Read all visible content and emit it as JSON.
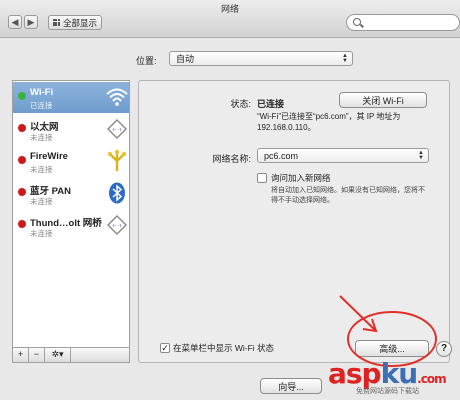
{
  "window": {
    "title": "网络"
  },
  "toolbar": {
    "back": "◀",
    "forward": "▶",
    "show_all": "全部显示",
    "search_placeholder": ""
  },
  "location": {
    "label": "位置:",
    "value": "自动"
  },
  "services": [
    {
      "name": "Wi-Fi",
      "status": "已连接",
      "dot_color": "#3cb43c",
      "icon": "wifi-icon"
    },
    {
      "name": "以太网",
      "status": "未连接",
      "dot_color": "#d01818",
      "icon": "ethernet-icon"
    },
    {
      "name": "FireWire",
      "status": "未连接",
      "dot_color": "#d01818",
      "icon": "firewire-icon"
    },
    {
      "name": "蓝牙 PAN",
      "status": "未连接",
      "dot_color": "#d01818",
      "icon": "bluetooth-icon"
    },
    {
      "name": "Thund…olt 网桥",
      "status": "未连接",
      "dot_color": "#d01818",
      "icon": "thunderbolt-bridge-icon"
    }
  ],
  "sidebar_footer": {
    "add": "+",
    "remove": "−",
    "gear": "✲▾"
  },
  "detail": {
    "status_label": "状态:",
    "status_value": "已连接",
    "toggle_wifi": "关闭 Wi-Fi",
    "status_desc_line1": "“Wi-Fi”已连接至“pc6.com”，其 IP 地址为",
    "status_desc_line2": "192.168.0.110。",
    "network_name_label": "网络名称:",
    "network_name_value": "pc6.com",
    "ask_join_label": "询问加入新网络",
    "ask_join_desc_line1": "将自动加入已知网络。如果没有已知网络，您将不",
    "ask_join_desc_line2": "得不手动选择网络。",
    "show_in_menubar_label": "在菜单栏中显示 Wi-Fi 状态",
    "advanced": "高级...",
    "help": "?",
    "assist": "向导..."
  },
  "watermark": {
    "brand_a": "asp",
    "brand_b": "ku",
    "suffix": ".com",
    "sub": "免费网站源码下载站"
  },
  "colors": {
    "selected_row": "#7fa7d6",
    "annotation": "#e0302a"
  }
}
